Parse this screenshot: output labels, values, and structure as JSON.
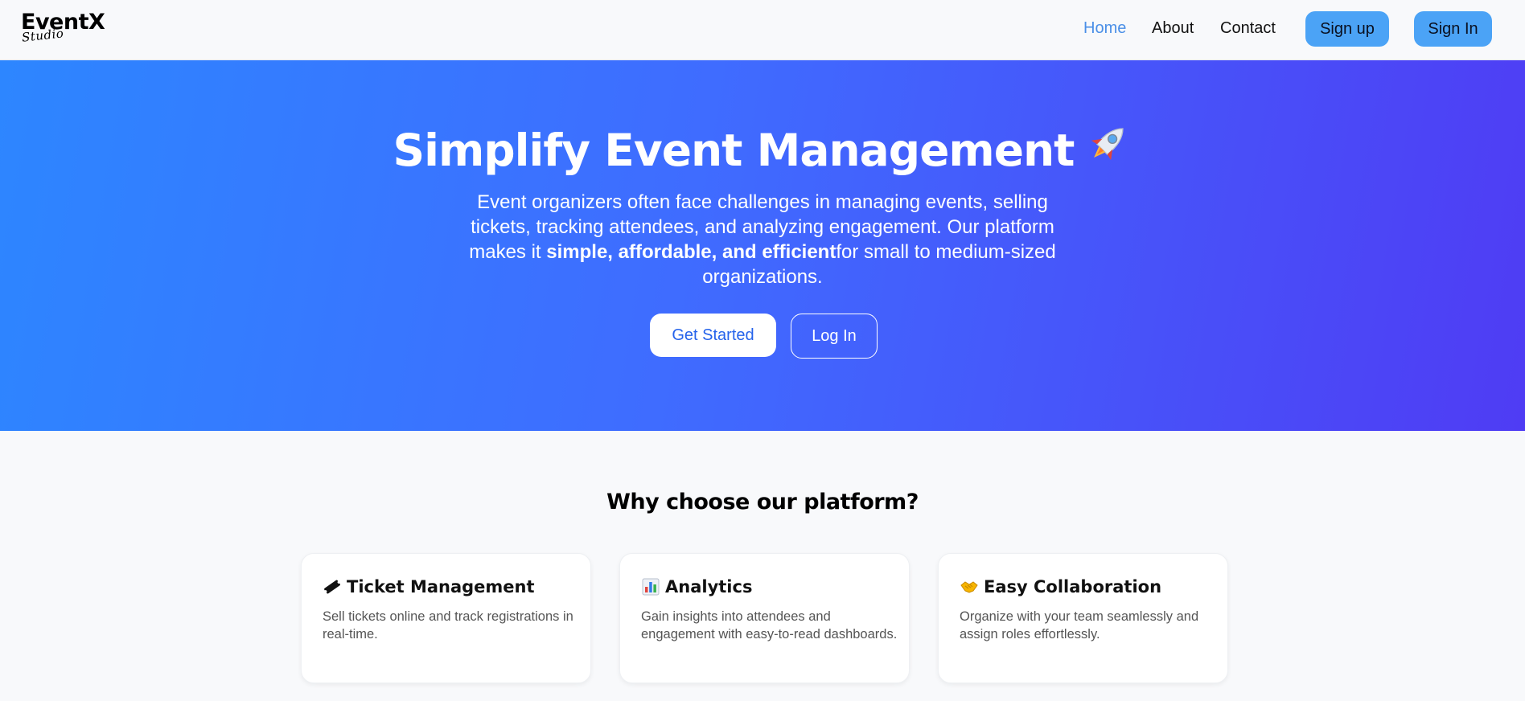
{
  "brand": {
    "name": "EventX",
    "sub": "Studio"
  },
  "nav": {
    "links": [
      {
        "label": "Home",
        "active": true
      },
      {
        "label": "About",
        "active": false
      },
      {
        "label": "Contact",
        "active": false
      }
    ],
    "signup_label": "Sign up",
    "signin_label": "Sign In"
  },
  "hero": {
    "title": "Simplify Event Management",
    "icon": "rocket-icon",
    "desc_before": "Event organizers often face challenges in managing events, selling tickets, tracking attendees, and analyzing engagement. Our platform makes it ",
    "desc_bold": "simple, affordable, and efficient",
    "desc_after": "for small to medium-sized organizations.",
    "primary_cta": "Get Started",
    "secondary_cta": "Log In"
  },
  "features": {
    "heading": "Why choose our platform?",
    "cards": [
      {
        "icon": "ticket-icon",
        "title": "Ticket Management",
        "text": "Sell tickets online and track registrations in real-time."
      },
      {
        "icon": "bar-chart-icon",
        "title": "Analytics",
        "text": "Gain insights into attendees and engagement with easy-to-read dashboards."
      },
      {
        "icon": "handshake-icon",
        "title": "Easy Collaboration",
        "text": "Organize with your team seamlessly and assign roles effortlessly."
      }
    ]
  },
  "colors": {
    "accent": "#4ba3f6",
    "link_active": "#4a8fe7",
    "hero_start": "#2d86ff",
    "hero_end": "#4f3cf4"
  }
}
